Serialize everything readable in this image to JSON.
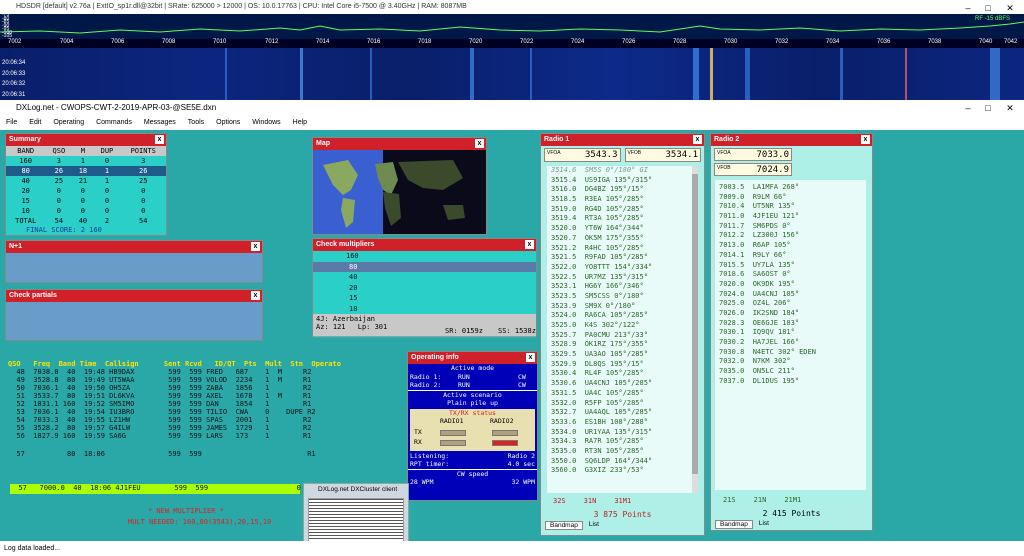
{
  "hdsdr": {
    "title": "HDSDR [default]  v2.76a  |  ExtIO_sp1r.dll@32bit  |  SRate: 625000 > 12000  |  OS: 10.0.17763  |  CPU: Intel Core i5-7500 @ 3.40GHz  |  RAM: 8087MB",
    "scale_left": [
      "-75",
      "-80",
      "-85",
      "-90",
      "-95",
      "-100",
      "-105"
    ],
    "rf_label": "RF -15 dBFS",
    "freqs": [
      "7002",
      "7004",
      "7006",
      "7008",
      "7010",
      "7012",
      "7014",
      "7016",
      "7018",
      "7020",
      "7022",
      "7024",
      "7026",
      "7028",
      "7030",
      "7032",
      "7034",
      "7036",
      "7038",
      "7040",
      "7042"
    ],
    "times": [
      "20:06:34",
      "20:06:33",
      "20:06:32",
      "20:06:31"
    ]
  },
  "dxlog": {
    "title": "DXLog.net - CWOPS-CWT-2-2019-APR-03-@SE5E.dxn",
    "menu": [
      "File",
      "Edit",
      "Operating",
      "Commands",
      "Messages",
      "Tools",
      "Options",
      "Windows",
      "Help"
    ]
  },
  "summary": {
    "title": "Summary",
    "headers": [
      "BAND",
      "QSO",
      "M",
      "DUP",
      "POINTS"
    ],
    "rows": [
      [
        "160",
        "3",
        "1",
        "0",
        "3"
      ],
      [
        "80",
        "26",
        "18",
        "1",
        "26"
      ],
      [
        "40",
        "25",
        "21",
        "1",
        "25"
      ],
      [
        "20",
        "0",
        "0",
        "0",
        "0"
      ],
      [
        "15",
        "0",
        "0",
        "0",
        "0"
      ],
      [
        "10",
        "0",
        "0",
        "0",
        "0"
      ],
      [
        "TOTAL",
        "54",
        "40",
        "2",
        "54"
      ]
    ],
    "final": "FINAL SCORE: 2 160"
  },
  "n1": {
    "title": "N+1"
  },
  "partials": {
    "title": "Check partials"
  },
  "map": {
    "title": "Map"
  },
  "checkmult": {
    "title": "Check multipliers",
    "bands": [
      "160",
      "80",
      "40",
      "20",
      "15",
      "10"
    ],
    "country": "4J: Azerbaijan",
    "az": "Az: 121",
    "lp": "Lp: 301",
    "sr": "SR: 0159z",
    "ss": "SS: 1538z"
  },
  "qso": {
    "headers": "QSO   Freq  Band Time  Callsign      Sent Rcvd   ID/QT  Pts  Mult  Stn  Operato",
    "rows": [
      "  48  7038.0  40  19:48 HB9DAX        599  599 FRED   687    1  M     R2",
      "  49  3528.8  80  19:49 UT5WAA        599  599 VOLOD  2234   1  M     R1",
      "  50  7036.1  40  19:50 OH5ZA         599  599 ZABA   1856   1        R2",
      "  51  3533.7  80  19:51 DL6KVA        599  599 AXEL   1678   1  M     R1",
      "  52  1831.1 160  19:52 SM5IMO        599  599 DAN    1854   1        R1",
      "  53  7036.1  40  19:54 IU3BRO        599  599 TILIO  CWA    0    DUPE R2",
      "  54  7033.3  40  19:55 LZ1HW         599  599 SPAS   2001   1        R2",
      "  55  3528.2  80  19:57 G4ILW         599  599 JAMES  1729   1        R2",
      "  56  1827.9 160  19:59 SA6G          599  599 LARS   173    1        R1"
    ],
    "blank": "  57          80  18:06               599  599                         R1",
    "entry": "  57   7000.0  40  18:06 4J1FEU        599  599                     0",
    "newmult": "* NEW MULTIPLIER *",
    "needed": "MULT NEEDED: 160,80(3543),20,15,10"
  },
  "radio1": {
    "title": "Radio 1",
    "vfoa_label": "VFOA",
    "vfoa": "3543.3",
    "vfob_label": "VFOB",
    "vfob": "3534.1",
    "bandmap": [
      "3514.6  SM5S 0°/180° GI",
      "3515.4  US9IGA 135°/315°",
      "3516.0  DG4BZ 195°/15°",
      "3518.5  R3EA 105°/285°",
      "3519.0  RG4D 105°/285°",
      "3519.4  RT3A 105°/285°",
      "3520.0  YT6W 164°/344°",
      "3520.7  OK5M 175°/355°",
      "3521.2  R4HC 105°/285°",
      "3521.5  R9FAD 105°/285°",
      "3522.0  YO8TTT 154°/334°",
      "3522.5  UR7MZ 135°/315°",
      "3523.1  HG6Y 166°/346°",
      "3523.5  SM5CSS 0°/180°",
      "3523.9  SM9X 0°/180°",
      "3524.0  RA6CA 105°/285°",
      "3525.0  K4S 302°/122°",
      "3525.7  PA0CMU 213°/33°",
      "3528.9  OK1RZ 175°/355°",
      "3529.5  UA3AO 105°/285°",
      "3529.9  DL8QS 195°/15°",
      "3530.4  RL4F 105°/285°",
      "3530.6  UA4CNJ 105°/285°",
      "3531.5  UA4C 105°/285°",
      "3532.0  R5FP 105°/285°",
      "3532.7  UA4AQL 105°/285°",
      "3533.6  ES1BH 108°/288°",
      "3534.0  UR1YAA 135°/315°",
      "3534.3  RA7R 105°/285°",
      "3535.0  RT3N 105°/285°",
      "3550.0  SQ6LDP 164°/344°",
      "3560.0  G3XIZ 233°/53°"
    ],
    "s1": "32S",
    "s2": "31N",
    "s3": "31M1",
    "points": "3 875 Points",
    "tab1": "Bandmap",
    "tab2": "List"
  },
  "radio2": {
    "title": "Radio 2",
    "vfoa_label": "VFOA",
    "vfoa": "7033.0",
    "vfob_label": "VFOB",
    "vfob": "7024.9",
    "bandmap": [
      "7003.5  LA1MFA 268°",
      "7009.0  R9LM 66°",
      "7010.4  UT5NR 135°",
      "7011.0  4JF1EU 121°",
      "7011.7  SM6PDS 0°",
      "7012.2  LZ300J 156°",
      "7013.0  R6AP 105°",
      "7014.1  R9LY 66°",
      "7015.5  UY7LA 135°",
      "7018.6  SA6OST 0°",
      "7020.0  OK9DK 195°",
      "7024.0  UA4CNJ 105°",
      "7025.0  OZ4L 206°",
      "7026.0  IK2SND 184°",
      "7028.3  OE6GJE 183°",
      "7030.1  IQ9QV 181°",
      "7030.2  HA7JEL 166°",
      "7030.8  N4ETC 302° EDEN",
      "7032.0  N7KM 302°",
      "7035.0  ON5LC 211°",
      "7037.0  DL1DUS 195°"
    ],
    "s1": "21S",
    "s2": "21N",
    "s3": "21M1",
    "points": "2 415 Points",
    "tab1": "Bandmap",
    "tab2": "List"
  },
  "opinfo": {
    "title": "Operating info",
    "active_mode": "Active mode",
    "r1": "Radio 1:",
    "r1run": "RUN",
    "r1cw": "CW",
    "r2": "Radio 2:",
    "r2run": "RUN",
    "r2cw": "CW",
    "scenario": "Active scenario",
    "pileup": "Plain pile up",
    "txrx": "TX/RX status",
    "radio1": "RADIO1",
    "radio2": "RADIO2",
    "tx": "TX",
    "rx": "RX",
    "listening": "Listening:",
    "listening_val": "Radio 2",
    "rpt": "RPT timer:",
    "rpt_val": "4.0 sec",
    "cwspeed": "CW speed",
    "wpm_l": "28 WPM",
    "wpm_r": "32 WPM"
  },
  "cluster": {
    "title": "DXLog.net DXCluster client"
  },
  "status": "Log data loaded..."
}
